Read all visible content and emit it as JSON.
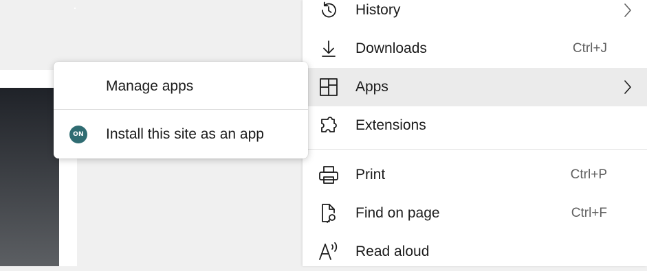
{
  "menu": {
    "items": [
      {
        "label": "History",
        "shortcut": "",
        "icon": "history-icon",
        "has_submenu": true
      },
      {
        "label": "Downloads",
        "shortcut": "Ctrl+J",
        "icon": "download-icon",
        "has_submenu": false
      },
      {
        "label": "Apps",
        "shortcut": "",
        "icon": "apps-icon",
        "has_submenu": true,
        "highlighted": true
      },
      {
        "label": "Extensions",
        "shortcut": "",
        "icon": "puzzle-icon",
        "has_submenu": false
      },
      {
        "label": "Print",
        "shortcut": "Ctrl+P",
        "icon": "printer-icon",
        "has_submenu": false
      },
      {
        "label": "Find on page",
        "shortcut": "Ctrl+F",
        "icon": "find-on-page-icon",
        "has_submenu": false
      },
      {
        "label": "Read aloud",
        "shortcut": "",
        "icon": "read-aloud-icon",
        "has_submenu": false
      }
    ]
  },
  "apps_submenu": {
    "items": [
      {
        "label": "Manage apps",
        "icon": ""
      },
      {
        "label": "Install this site as an app",
        "icon": "site-favicon",
        "badge_text": "ON",
        "badge_color": "#2f6c72"
      }
    ]
  },
  "colors": {
    "highlight": "#ebebeb",
    "text": "#1b1b1b",
    "shortcut": "#5f5f5f"
  }
}
